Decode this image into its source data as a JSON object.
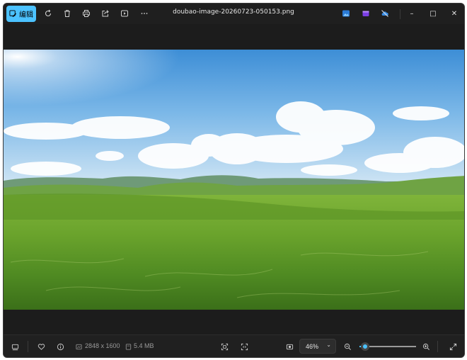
{
  "titlebar": {
    "edit_label": "编辑",
    "filename": "doubao-image-20260723-050153.png",
    "icons": [
      "rotate-icon",
      "delete-icon",
      "print-icon",
      "share-icon",
      "slideshow-icon",
      "more-icon"
    ],
    "window_controls": {
      "minimize": "–",
      "maximize": "□",
      "close": "✕"
    }
  },
  "statusbar": {
    "dimensions": "2848 x 1600",
    "file_size": "5.4 MB",
    "zoom_value": "46%",
    "zoom_level": 0.1
  },
  "colors": {
    "accent": "#4cc2ff",
    "background": "#1f1f1f"
  }
}
